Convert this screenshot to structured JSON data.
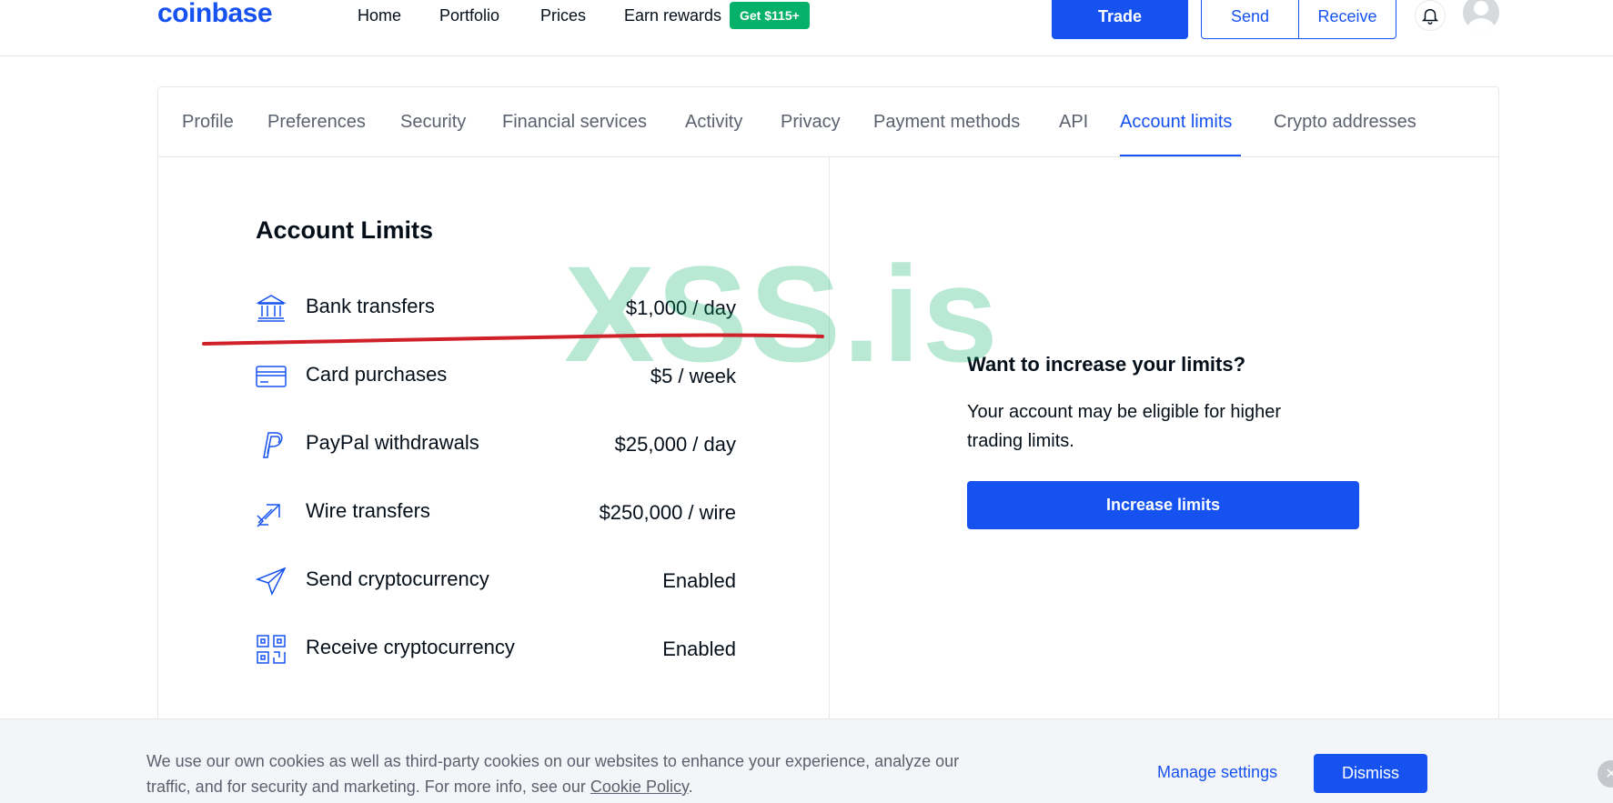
{
  "brand": {
    "logo": "coinbase"
  },
  "nav": {
    "home": "Home",
    "portfolio": "Portfolio",
    "prices": "Prices",
    "earn": "Earn rewards",
    "earn_badge": "Get $115+",
    "trade": "Trade",
    "send": "Send",
    "receive": "Receive"
  },
  "tabs": [
    {
      "label": "Profile"
    },
    {
      "label": "Preferences"
    },
    {
      "label": "Security"
    },
    {
      "label": "Financial services"
    },
    {
      "label": "Activity"
    },
    {
      "label": "Privacy"
    },
    {
      "label": "Payment methods"
    },
    {
      "label": "API"
    },
    {
      "label": "Account limits",
      "active": true
    },
    {
      "label": "Crypto addresses"
    }
  ],
  "limits": {
    "title": "Account Limits",
    "rows": [
      {
        "icon": "bank-icon",
        "label": "Bank transfers",
        "value": "$1,000 / day"
      },
      {
        "icon": "card-icon",
        "label": "Card purchases",
        "value": "$5 / week"
      },
      {
        "icon": "paypal-icon",
        "label": "PayPal withdrawals",
        "value": "$25,000 / day"
      },
      {
        "icon": "wire-icon",
        "label": "Wire transfers",
        "value": "$250,000 / wire"
      },
      {
        "icon": "send-icon",
        "label": "Send cryptocurrency",
        "value": "Enabled"
      },
      {
        "icon": "qr-icon",
        "label": "Receive cryptocurrency",
        "value": "Enabled"
      }
    ]
  },
  "promo": {
    "title": "Want to increase your limits?",
    "text": "Your account may be eligible for higher trading limits.",
    "button": "Increase limits"
  },
  "watermark": "XSS.is",
  "cookie": {
    "text": "We use our own cookies as well as third-party cookies on our websites to enhance your experience, analyze our traffic, and for security and marketing. For more info, see our",
    "link": "Cookie Policy",
    "period": ".",
    "manage": "Manage settings",
    "dismiss": "Dismiss",
    "close": "×"
  },
  "colors": {
    "primary": "#1652f0",
    "green": "#05b169",
    "text": "#050f19",
    "muted": "#5b616e"
  }
}
